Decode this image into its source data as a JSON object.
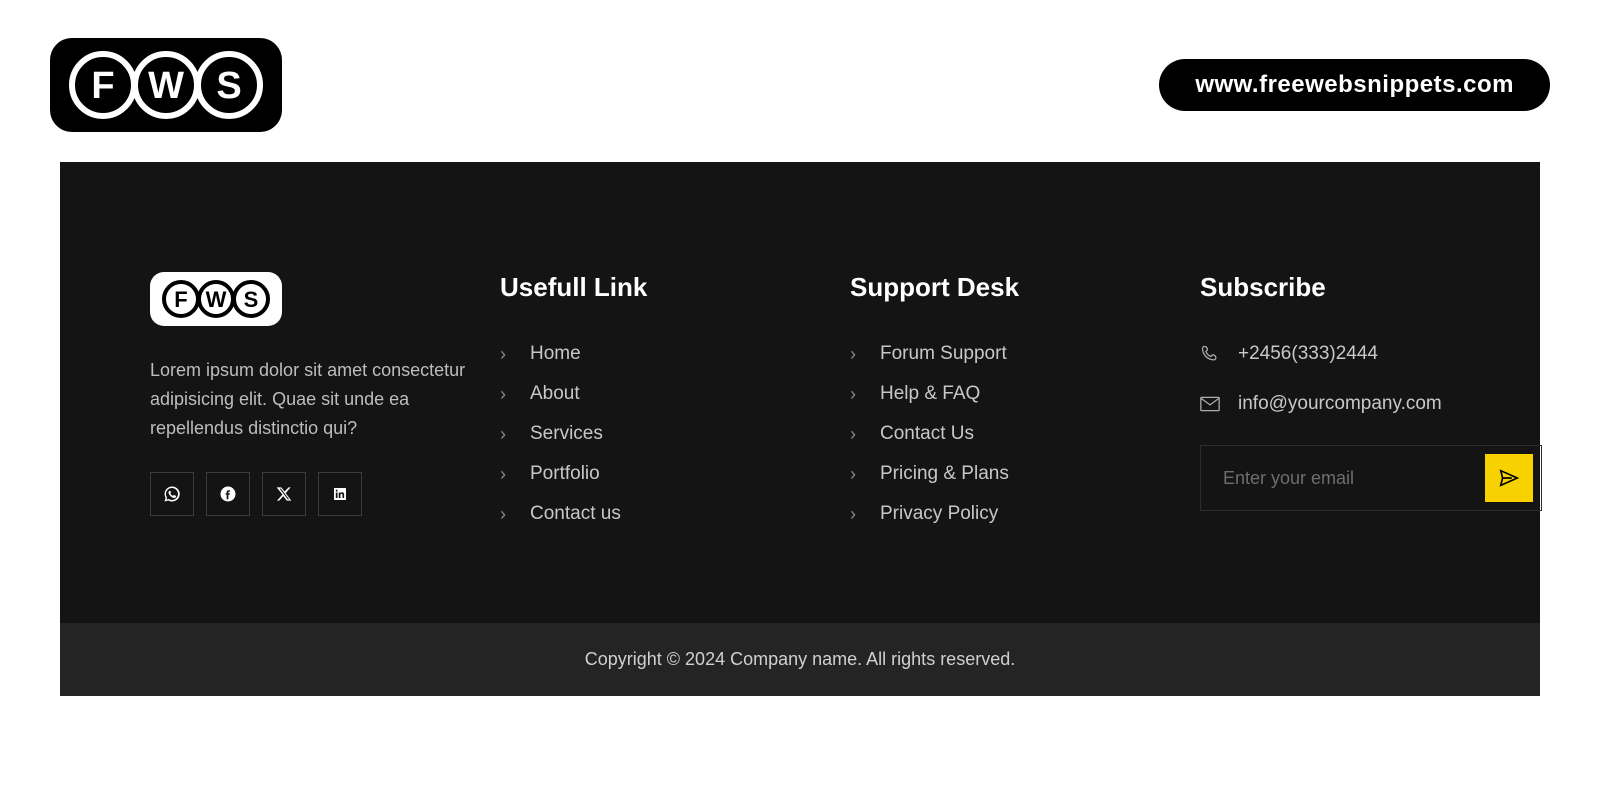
{
  "header": {
    "logo_letters": [
      "F",
      "W",
      "S"
    ],
    "url": "www.freewebsnippets.com"
  },
  "footer": {
    "about": {
      "logo_letters": [
        "F",
        "W",
        "S"
      ],
      "text": "Lorem ipsum dolor sit amet consectetur adipisicing elit. Quae sit unde ea repellendus distinctio qui?",
      "social": [
        "whatsapp",
        "facebook",
        "x",
        "linkedin"
      ]
    },
    "links": {
      "title": "Usefull Link",
      "items": [
        "Home",
        "About",
        "Services",
        "Portfolio",
        "Contact us"
      ]
    },
    "support": {
      "title": "Support Desk",
      "items": [
        "Forum Support",
        "Help & FAQ",
        "Contact Us",
        "Pricing & Plans",
        "Privacy Policy"
      ]
    },
    "subscribe": {
      "title": "Subscribe",
      "phone": "+2456(333)2444",
      "email": "info@yourcompany.com",
      "placeholder": "Enter your email"
    },
    "copyright": "Copyright © 2024 Company name. All rights reserved."
  }
}
